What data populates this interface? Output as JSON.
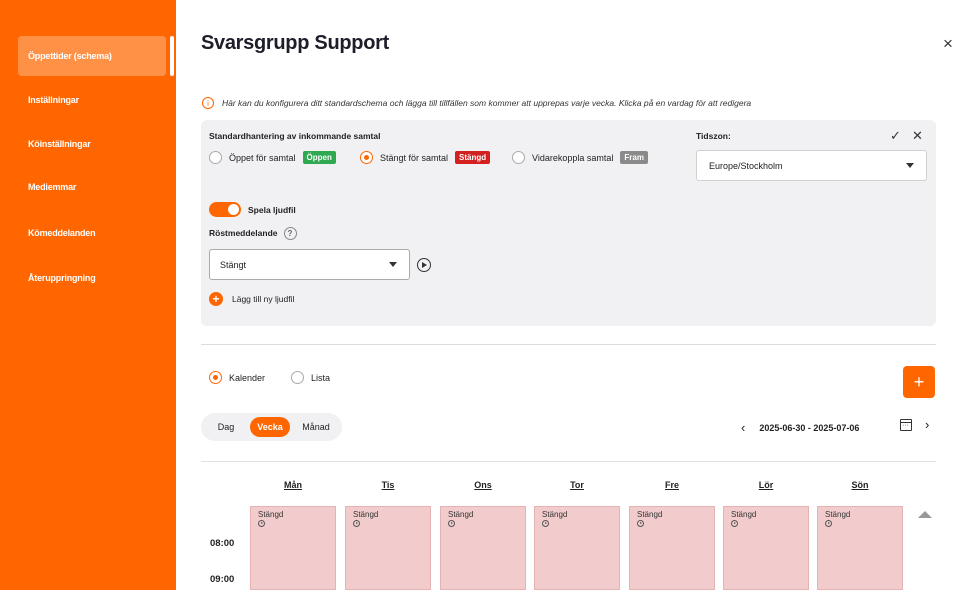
{
  "sidebar": {
    "items": [
      {
        "label": "Öppettider (schema)",
        "active": true
      },
      {
        "label": "Inställningar"
      },
      {
        "label": "Köinställningar"
      },
      {
        "label": "Mediemmar"
      },
      {
        "label": "Kömeddelanden"
      },
      {
        "label": "Återuppringning"
      }
    ],
    "accent": "#ff6600"
  },
  "header": {
    "title": "Svarsgrupp Support",
    "close": "×"
  },
  "info": {
    "icon": "i",
    "text": "Här kan du konfigurera ditt standardschema och lägga till tillfällen som kommer att upprepas varje vecka. Klicka på en vardag för att redigera"
  },
  "panel": {
    "handling_label": "Standardhantering av inkommande samtal",
    "options": [
      {
        "label": "Öppet för samtal",
        "badge": "Öppen",
        "badge_color": "#2fa84f",
        "selected": false
      },
      {
        "label": "Stängt för samtal",
        "badge": "Stängd",
        "badge_color": "#d32020",
        "selected": true
      },
      {
        "label": "Vidarekoppla samtal",
        "badge": "Fram",
        "badge_color": "#8a8a8a",
        "selected": false
      }
    ],
    "timezone_label": "Tidszon:",
    "timezone_value": "Europe/Stockholm",
    "confirm": "✓",
    "cancel": "✕",
    "play_sound_label": "Spela ljudfil",
    "play_sound_on": true,
    "voice_label": "Röstmeddelande",
    "voice_help": "?",
    "voice_value": "Stängt",
    "add_sound_label": "Lägg till ny ljudfil"
  },
  "view": {
    "calendar_label": "Kalender",
    "list_label": "Lista",
    "selected": "Kalender",
    "add": "+",
    "segments": [
      "Dag",
      "Vecka",
      "Månad"
    ],
    "active_segment": "Vecka",
    "prev": "‹",
    "next": "›",
    "date_range": "2025-06-30 - 2025-07-06"
  },
  "calendar": {
    "days": [
      {
        "label": "Mån",
        "status": "Stängd"
      },
      {
        "label": "Tis",
        "status": "Stängd"
      },
      {
        "label": "Ons",
        "status": "Stängd"
      },
      {
        "label": "Tor",
        "status": "Stängd"
      },
      {
        "label": "Fre",
        "status": "Stängd"
      },
      {
        "label": "Lör",
        "status": "Stängd"
      },
      {
        "label": "Sön",
        "status": "Stängd"
      }
    ],
    "times": [
      "08:00",
      "09:00"
    ],
    "closed_color": "#f2cccc"
  }
}
